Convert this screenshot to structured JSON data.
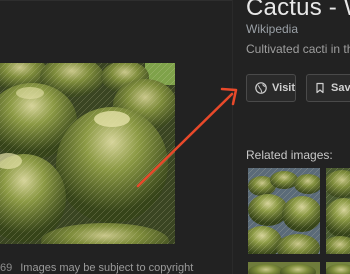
{
  "panel": {
    "title": "Cactus - Wik",
    "source": "Wikipedia",
    "subtitle": "Cultivated cacti in the"
  },
  "actions": {
    "visit_label": "Visit",
    "save_label": "Save"
  },
  "related": {
    "label": "Related images:"
  },
  "caption": {
    "number": "69",
    "text": "Images may be subject to copyright"
  },
  "icons": {
    "visit": "globe-icon",
    "save": "bookmark-icon"
  },
  "colors": {
    "background": "#222222",
    "annotation_arrow": "#e8492a"
  }
}
